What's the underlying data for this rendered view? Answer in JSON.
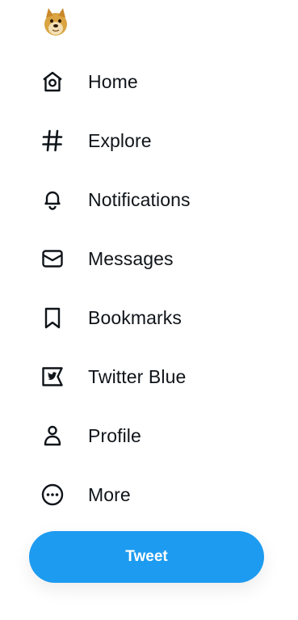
{
  "logo": {
    "icon": "doge-avatar-icon"
  },
  "nav": {
    "items": [
      {
        "label": "Home",
        "icon": "home-icon"
      },
      {
        "label": "Explore",
        "icon": "hashtag-icon"
      },
      {
        "label": "Notifications",
        "icon": "bell-icon"
      },
      {
        "label": "Messages",
        "icon": "envelope-icon"
      },
      {
        "label": "Bookmarks",
        "icon": "bookmark-icon"
      },
      {
        "label": "Twitter Blue",
        "icon": "twitter-blue-icon"
      },
      {
        "label": "Profile",
        "icon": "person-icon"
      },
      {
        "label": "More",
        "icon": "more-circle-icon"
      }
    ]
  },
  "tweet_button": {
    "label": "Tweet"
  },
  "colors": {
    "accent": "#1d9bf0",
    "text": "#0f1419",
    "background": "#ffffff"
  }
}
